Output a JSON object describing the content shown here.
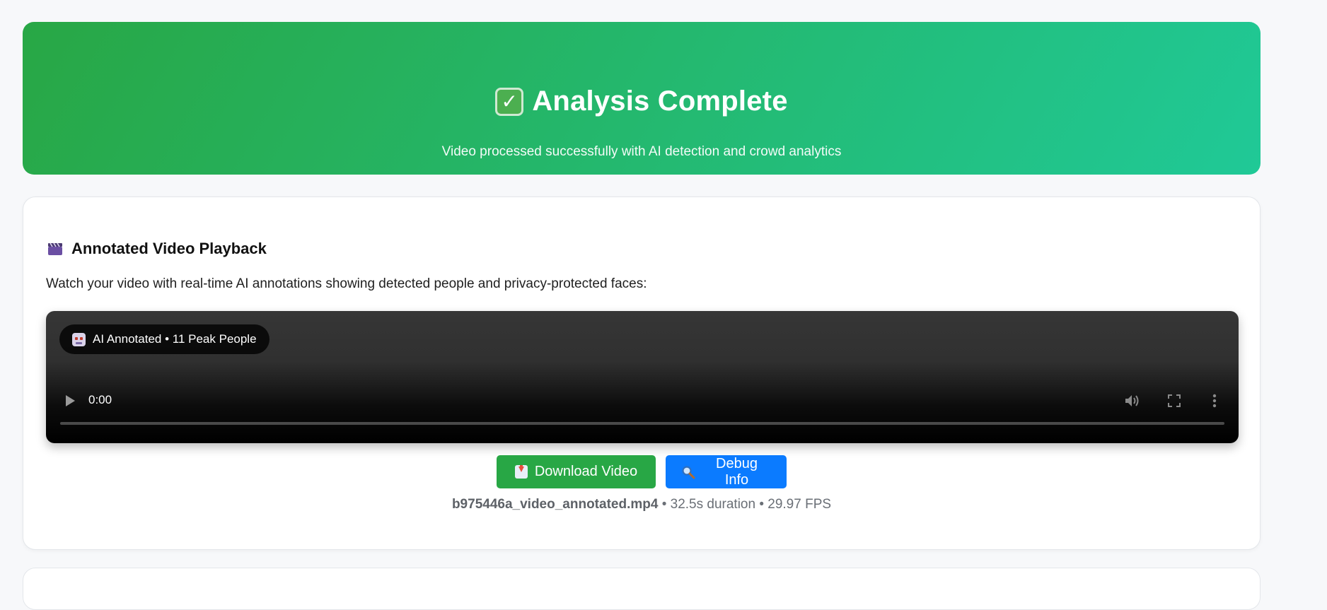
{
  "banner": {
    "title": "Analysis Complete",
    "subtitle": "Video processed successfully with AI detection and crowd analytics",
    "icon": "check-mark-icon",
    "gradient_from": "#28a745",
    "gradient_to": "#20c997"
  },
  "video_section": {
    "heading": "Annotated Video Playback",
    "heading_icon": "clapper-board-icon",
    "description": "Watch your video with real-time AI annotations showing detected people and privacy-protected faces:",
    "badge": "AI Annotated • 11 Peak People",
    "player": {
      "time": "0:00",
      "progress": 0
    },
    "buttons": {
      "download": "Download Video",
      "debug": "Debug Info"
    },
    "file": {
      "name": "b975446a_video_annotated.mp4",
      "details": " • 32.5s duration • 29.97 FPS"
    }
  },
  "colors": {
    "accent_green": "#28a745",
    "accent_blue": "#0b7bff"
  }
}
